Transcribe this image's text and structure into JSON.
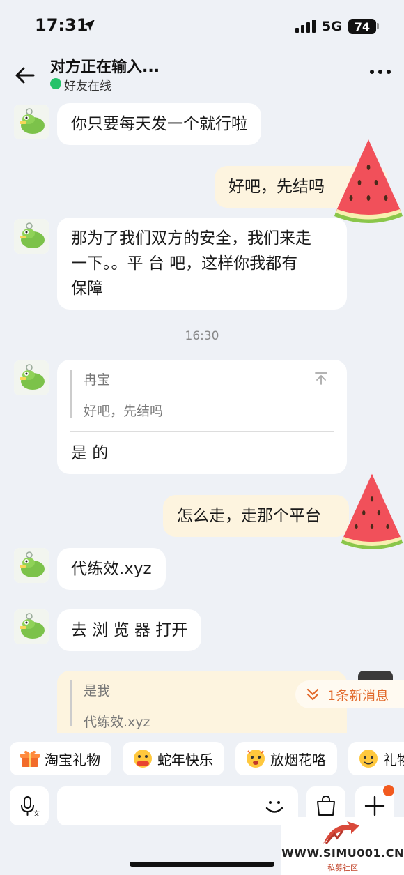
{
  "status_bar": {
    "time": "17:31",
    "network": "5G",
    "battery": "74"
  },
  "header": {
    "title": "对方正在输入...",
    "status": "好友在线"
  },
  "messages": [
    {
      "side": "in",
      "text": "你只要每天发一个就行啦"
    },
    {
      "side": "out",
      "text": "好吧，先结吗"
    },
    {
      "side": "in",
      "lines": [
        "那为了我们双方的安全，我们来走",
        "一下。。平 台 吧，这样你我都有",
        "保障"
      ]
    },
    {
      "side": "in",
      "quote": {
        "name": "冉宝",
        "text": "好吧，先结吗"
      },
      "text": "是 的"
    },
    {
      "side": "out",
      "text": "怎么走，走那个平台"
    },
    {
      "side": "in",
      "text": "代练效.xyz"
    },
    {
      "side": "in",
      "text": "去 浏 览 器 打开"
    },
    {
      "side": "in",
      "quote": {
        "name": "是我",
        "text": "代练效.xyz"
      }
    }
  ],
  "time_divider": "16:30",
  "new_message_pill": "1条新消息",
  "quick_chips": [
    "淘宝礼物",
    "蛇年快乐",
    "放烟花咯",
    "礼物"
  ],
  "input": {
    "placeholder": ""
  },
  "watermark": {
    "url": "WWW.SIMU001.CN",
    "subtitle": "私募社区"
  },
  "colors": {
    "online": "#25c26a",
    "outgoing_bubble": "#fdf4df",
    "accent": "#e26a2c"
  }
}
